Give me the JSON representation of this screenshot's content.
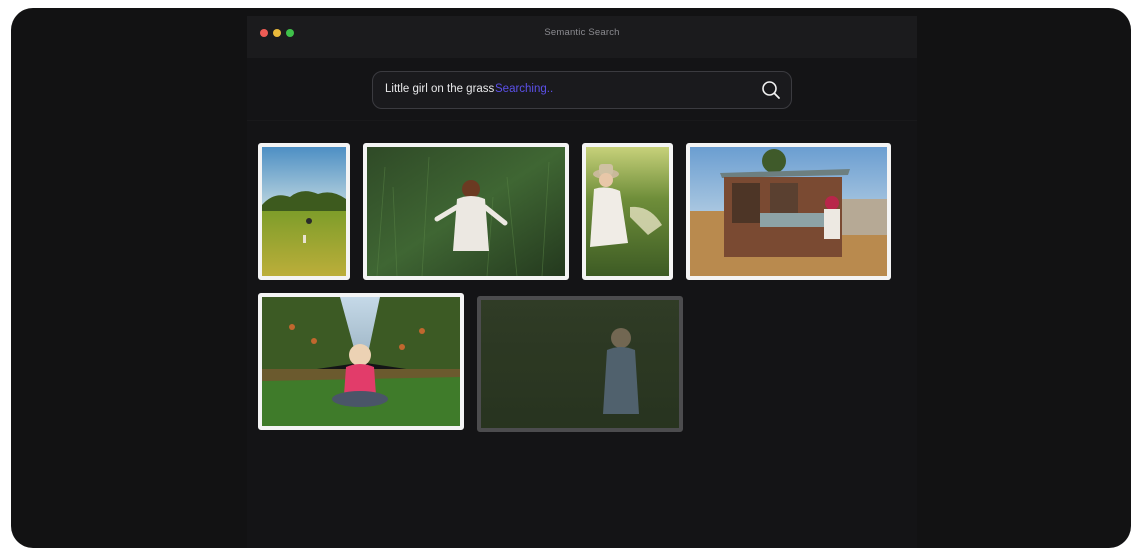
{
  "window": {
    "title": "Semantic Search"
  },
  "search": {
    "query": "Little girl on the grass",
    "status": "Searching..",
    "status_color": "#5b50e8"
  },
  "results": [
    {
      "subject": "child walking in field with balloons",
      "state": "loaded"
    },
    {
      "subject": "child in tall green grass from above",
      "state": "loaded"
    },
    {
      "subject": "girl with hat holding flowers in meadow",
      "state": "loaded"
    },
    {
      "subject": "girl in pink hood beside wooden shed",
      "state": "loaded"
    },
    {
      "subject": "toddler sitting in orchard grass eating apple",
      "state": "loaded"
    },
    {
      "subject": "toddler standing in grass",
      "state": "loading"
    }
  ]
}
